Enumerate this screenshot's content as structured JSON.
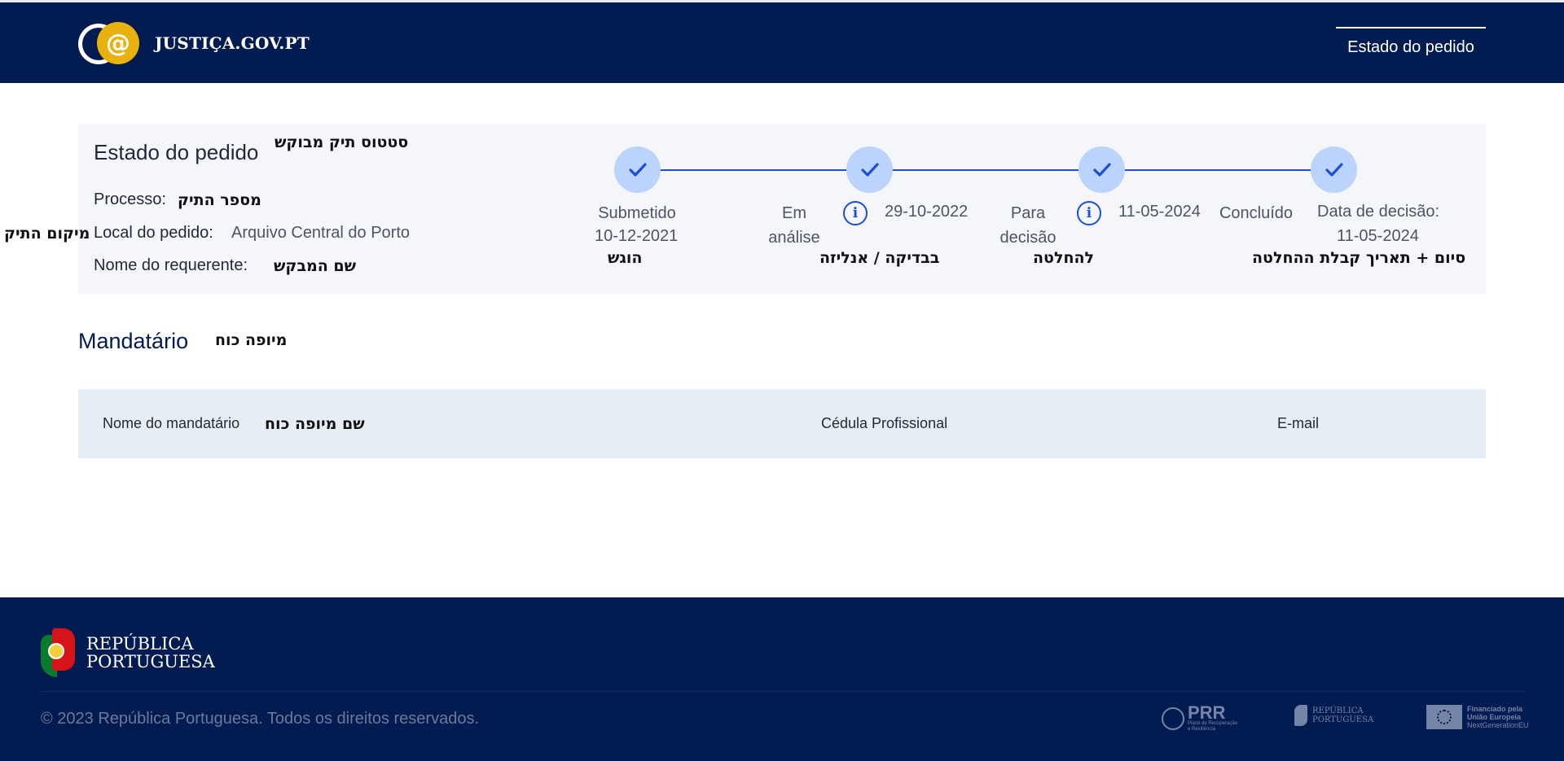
{
  "header": {
    "logo_text": "JUSTIÇA.GOV.PT",
    "nav_item": "Estado do pedido"
  },
  "status_panel": {
    "title": "Estado do pedido",
    "title_note": "סטטוס תיק מבוקש",
    "fields": [
      {
        "label": "Processo:",
        "value": "",
        "note": "מספר התיק"
      },
      {
        "label": "Local do pedido:",
        "value": "Arquivo Central do Porto",
        "note": "מיקום התיק"
      },
      {
        "label": "Nome do requerente:",
        "value": "",
        "note": "שם המבקש"
      }
    ],
    "steps": [
      {
        "label_line1": "Submetido",
        "label_line2": "",
        "date": "10-12-2021",
        "note": "הוגש",
        "has_info": false,
        "status": "complete"
      },
      {
        "label_line1": "Em",
        "label_line2": "análise",
        "date": "29-10-2022",
        "note": "בבדיקה / אנליזה",
        "has_info": true,
        "status": "complete"
      },
      {
        "label_line1": "Para",
        "label_line2": "decisão",
        "date": "11-05-2024",
        "note": "להחלטה",
        "has_info": true,
        "status": "complete"
      },
      {
        "label_line1": "Concluído",
        "label_line2": "",
        "date_label": "Data de decisão:",
        "date": "11-05-2024",
        "note": "סיום + תאריך קבלת ההחלטה",
        "has_info": false,
        "status": "complete"
      }
    ]
  },
  "mandatario": {
    "title": "Mandatário",
    "title_note": "מיופה כוח",
    "columns": [
      {
        "label": "Nome do mandatário",
        "note": "שם מיופה כוח"
      },
      {
        "label": "Cédula Profissional"
      },
      {
        "label": "E-mail"
      }
    ]
  },
  "footer": {
    "brand_line1": "REPÚBLICA",
    "brand_line2": "PORTUGUESA",
    "copyright": "© 2023 República Portuguesa. Todos os direitos reservados.",
    "partner_prr": "PRR",
    "partner_prr_sub1": "Plano de Recuperação",
    "partner_prr_sub2": "e Resiliência",
    "partner_rp_line1": "REPÚBLICA",
    "partner_rp_line2": "PORTUGUESA",
    "partner_eu_line1": "Financiado pela",
    "partner_eu_line2": "União Europeia",
    "partner_eu_line3": "NextGenerationEU"
  },
  "colors": {
    "navy": "#021b50",
    "step_circle": "#bcd3fb",
    "step_accent": "#1d4ed8",
    "panel_bg": "#f4f6f9",
    "table_header_bg": "#e6edf5",
    "gold": "#e8b10e"
  },
  "icons": [
    "check-icon",
    "info-icon",
    "at-sign-logo-icon",
    "flag-icon",
    "eu-flag-icon"
  ]
}
